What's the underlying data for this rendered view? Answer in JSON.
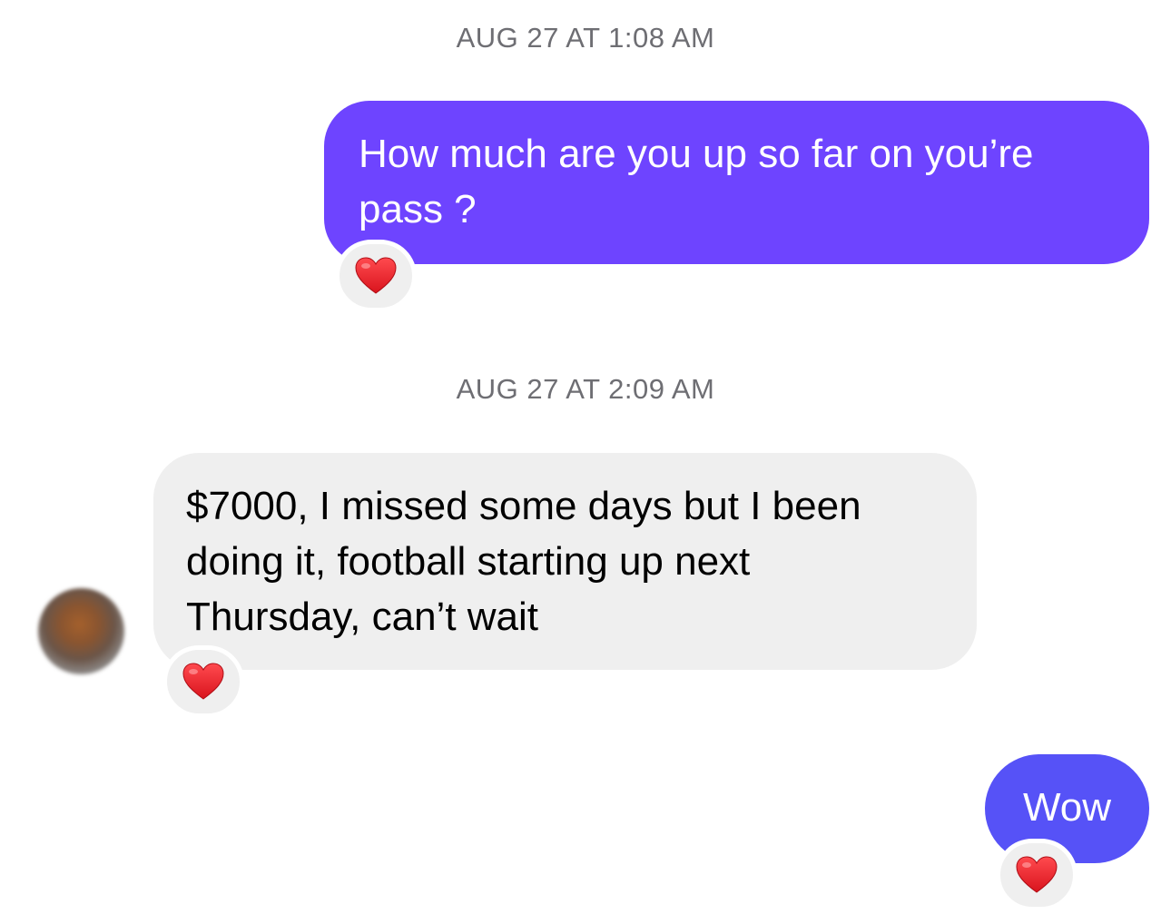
{
  "conversation": {
    "timestamps": [
      "AUG 27 AT 1:08 AM",
      "AUG 27 AT 2:09 AM"
    ],
    "messages": [
      {
        "direction": "outgoing",
        "lines": [
          "How much are you up so far on you’re",
          "pass ?"
        ],
        "reaction": "heart"
      },
      {
        "direction": "incoming",
        "lines": [
          "$7000, I missed some days but I been",
          "doing it, football starting up next",
          "Thursday, can’t wait"
        ],
        "reaction": "heart"
      },
      {
        "direction": "outgoing",
        "lines": [
          "Wow"
        ],
        "reaction": "heart"
      }
    ]
  },
  "colors": {
    "outgoing_bubble_1": "#6e44ff",
    "outgoing_bubble_2": "#5652f7",
    "incoming_bubble": "#efefef",
    "reaction_heart": "#e8202a",
    "timestamp_text": "#6e6e73"
  },
  "icons": {
    "reaction": "red-heart-emoji",
    "avatar": "blurred-profile-photo"
  }
}
